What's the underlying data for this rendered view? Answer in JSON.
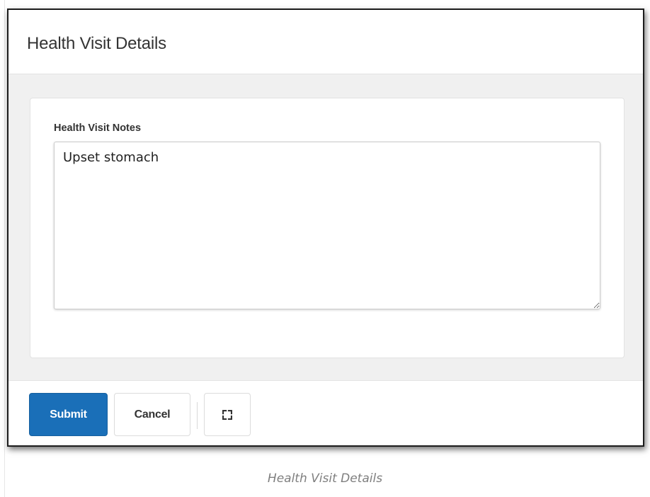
{
  "modal": {
    "title": "Health Visit Details"
  },
  "form": {
    "notes_label": "Health Visit Notes",
    "notes_value": "Upset stomach"
  },
  "footer": {
    "submit_label": "Submit",
    "cancel_label": "Cancel",
    "expand_icon": "expand-icon"
  },
  "caption": "Health Visit Details",
  "colors": {
    "primary_button": "#1a6fb8",
    "body_background": "#f0f0f0",
    "modal_border": "#1c1c1c"
  }
}
